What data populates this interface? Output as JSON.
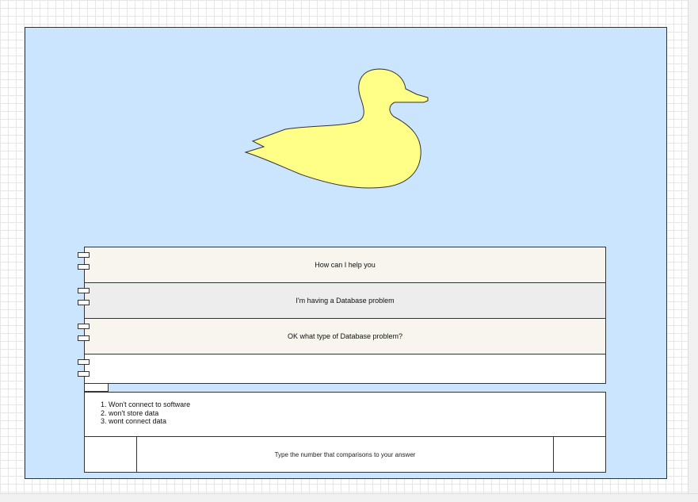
{
  "conversation": {
    "bot_greeting": "How can I help you",
    "user_message": "I'm having a Database problem",
    "bot_followup": "OK what type of Database problem?",
    "empty_reply": ""
  },
  "options": [
    "1. Won't connect to software",
    "2. won't store data",
    "3. wont connect data"
  ],
  "input": {
    "prompt": "Type the number that comparisons to your answer"
  },
  "colors": {
    "canvas_background": "#cce5ff",
    "duck_fill": "#ffff88",
    "bot_row": "#f7f5ee",
    "user_row": "#ededed"
  }
}
